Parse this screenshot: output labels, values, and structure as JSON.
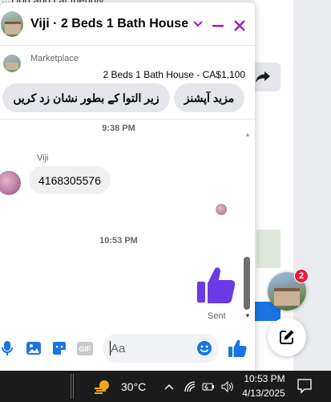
{
  "background": {
    "snippet_text": "Dog and cat friendly"
  },
  "chat": {
    "title": "Viji · 2 Beds 1 Bath House",
    "listing": {
      "source": "Marketplace",
      "title": "2 Beds 1 Bath House - CA$1,100"
    },
    "quick_replies": [
      "زیر التوا کے بطور نشان زد کریں",
      "مزید آپشنز"
    ],
    "messages": {
      "timestamp_1": "9:38 PM",
      "sender_name": "Viji",
      "incoming_text": "4168305576",
      "timestamp_2": "10:53 PM",
      "status": "Sent"
    },
    "composer": {
      "placeholder": "Aa",
      "gif_label": "GIF"
    },
    "accent_color": "#a022c8",
    "brand_color": "#1b74e4"
  },
  "floating": {
    "badge_count": "2"
  },
  "taskbar": {
    "temperature": "30°C",
    "time": "10:53 PM",
    "date": "4/13/2025"
  }
}
